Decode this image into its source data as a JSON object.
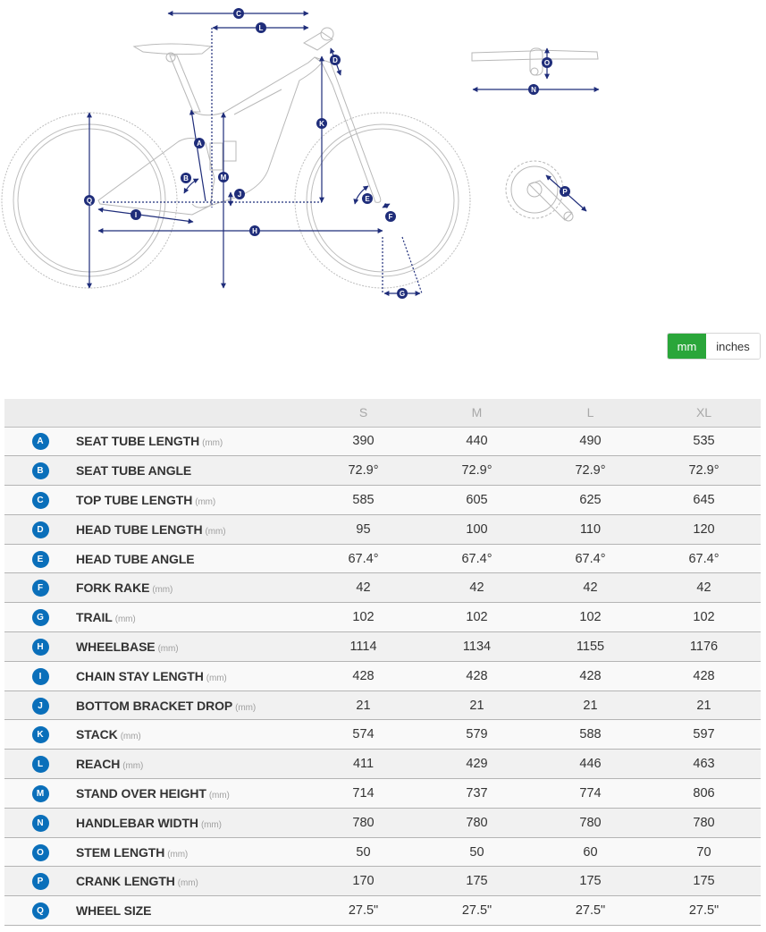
{
  "diagram": {
    "labels": [
      "A",
      "B",
      "C",
      "D",
      "E",
      "F",
      "G",
      "H",
      "I",
      "J",
      "K",
      "L",
      "M",
      "N",
      "O",
      "P",
      "Q"
    ],
    "line_color": "#1f2d7a",
    "drawing_color": "#b8b8b8"
  },
  "units_toggle": {
    "mm_label": "mm",
    "inches_label": "inches",
    "selected": "mm",
    "active_color": "#2aa63a"
  },
  "table": {
    "sizes": [
      "S",
      "M",
      "L",
      "XL"
    ],
    "badge_color": "#0a6fba",
    "rows": [
      {
        "letter": "A",
        "label": "SEAT TUBE LENGTH",
        "unit": "(mm)",
        "values": [
          "390",
          "440",
          "490",
          "535"
        ]
      },
      {
        "letter": "B",
        "label": "SEAT TUBE ANGLE",
        "unit": "",
        "values": [
          "72.9°",
          "72.9°",
          "72.9°",
          "72.9°"
        ]
      },
      {
        "letter": "C",
        "label": "TOP TUBE LENGTH",
        "unit": "(mm)",
        "values": [
          "585",
          "605",
          "625",
          "645"
        ]
      },
      {
        "letter": "D",
        "label": "HEAD TUBE LENGTH",
        "unit": "(mm)",
        "values": [
          "95",
          "100",
          "110",
          "120"
        ]
      },
      {
        "letter": "E",
        "label": "HEAD TUBE ANGLE",
        "unit": "",
        "values": [
          "67.4°",
          "67.4°",
          "67.4°",
          "67.4°"
        ]
      },
      {
        "letter": "F",
        "label": "FORK RAKE",
        "unit": "(mm)",
        "values": [
          "42",
          "42",
          "42",
          "42"
        ]
      },
      {
        "letter": "G",
        "label": "TRAIL",
        "unit": "(mm)",
        "values": [
          "102",
          "102",
          "102",
          "102"
        ]
      },
      {
        "letter": "H",
        "label": "WHEELBASE",
        "unit": "(mm)",
        "values": [
          "1114",
          "1134",
          "1155",
          "1176"
        ]
      },
      {
        "letter": "I",
        "label": "CHAIN STAY LENGTH",
        "unit": "(mm)",
        "values": [
          "428",
          "428",
          "428",
          "428"
        ]
      },
      {
        "letter": "J",
        "label": "BOTTOM BRACKET DROP",
        "unit": "(mm)",
        "values": [
          "21",
          "21",
          "21",
          "21"
        ]
      },
      {
        "letter": "K",
        "label": "STACK",
        "unit": "(mm)",
        "values": [
          "574",
          "579",
          "588",
          "597"
        ]
      },
      {
        "letter": "L",
        "label": "REACH",
        "unit": "(mm)",
        "values": [
          "411",
          "429",
          "446",
          "463"
        ]
      },
      {
        "letter": "M",
        "label": "STAND OVER HEIGHT",
        "unit": "(mm)",
        "values": [
          "714",
          "737",
          "774",
          "806"
        ]
      },
      {
        "letter": "N",
        "label": "HANDLEBAR WIDTH",
        "unit": "(mm)",
        "values": [
          "780",
          "780",
          "780",
          "780"
        ]
      },
      {
        "letter": "O",
        "label": "STEM LENGTH",
        "unit": "(mm)",
        "values": [
          "50",
          "50",
          "60",
          "70"
        ]
      },
      {
        "letter": "P",
        "label": "CRANK LENGTH",
        "unit": "(mm)",
        "values": [
          "170",
          "175",
          "175",
          "175"
        ]
      },
      {
        "letter": "Q",
        "label": "WHEEL SIZE",
        "unit": "",
        "values": [
          "27.5\"",
          "27.5\"",
          "27.5\"",
          "27.5\""
        ]
      }
    ]
  }
}
